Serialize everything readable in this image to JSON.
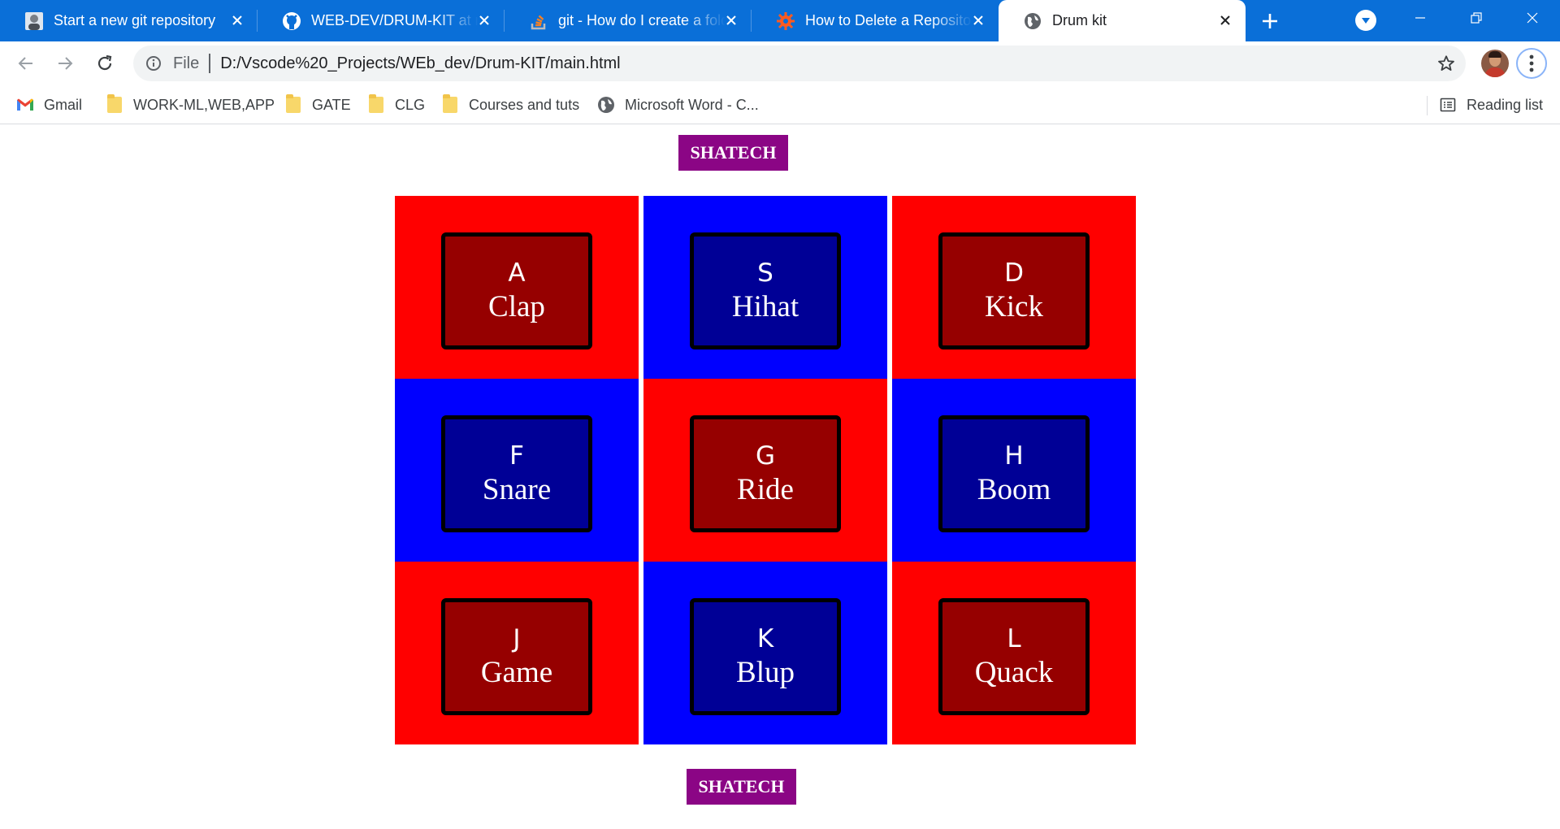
{
  "browser": {
    "tabs": [
      {
        "title": "Start a new git repository",
        "favicon": "user-avatar-icon",
        "active": false
      },
      {
        "title": "WEB-DEV/DRUM-KIT at main",
        "favicon": "github-icon",
        "active": false
      },
      {
        "title": "git - How do I create a folder",
        "favicon": "stackoverflow-icon",
        "active": false
      },
      {
        "title": "How to Delete a Repository",
        "favicon": "gear-orange-icon",
        "active": false
      },
      {
        "title": "Drum kit",
        "favicon": "globe-icon",
        "active": true
      }
    ],
    "tab_bar_color": "#0a6fd8",
    "address": {
      "scheme_label": "File",
      "url": "D:/Vscode%20_Projects/WEb_dev/Drum-KIT/main.html"
    },
    "bookmarks": [
      {
        "label": "Gmail",
        "icon": "gmail-icon"
      },
      {
        "label": "WORK-ML,WEB,APP",
        "icon": "folder-icon"
      },
      {
        "label": "GATE",
        "icon": "folder-icon"
      },
      {
        "label": "CLG",
        "icon": "folder-icon"
      },
      {
        "label": "Courses and tuts",
        "icon": "folder-icon"
      },
      {
        "label": "Microsoft Word - C...",
        "icon": "globe-icon"
      }
    ],
    "reading_list_label": "Reading list"
  },
  "page": {
    "brand_top": "SHATECH",
    "brand_bottom": "SHATECH",
    "brand_color": "#8b0585",
    "pads": [
      {
        "key": "A",
        "sound": "Clap",
        "cell_color": "#ff0000",
        "pad_color": "#960000"
      },
      {
        "key": "S",
        "sound": "Hihat",
        "cell_color": "#0000ff",
        "pad_color": "#000096"
      },
      {
        "key": "D",
        "sound": "Kick",
        "cell_color": "#ff0000",
        "pad_color": "#960000"
      },
      {
        "key": "F",
        "sound": "Snare",
        "cell_color": "#0000ff",
        "pad_color": "#000096"
      },
      {
        "key": "G",
        "sound": "Ride",
        "cell_color": "#ff0000",
        "pad_color": "#960000"
      },
      {
        "key": "H",
        "sound": "Boom",
        "cell_color": "#0000ff",
        "pad_color": "#000096"
      },
      {
        "key": "J",
        "sound": "Game",
        "cell_color": "#ff0000",
        "pad_color": "#960000"
      },
      {
        "key": "K",
        "sound": "Blup",
        "cell_color": "#0000ff",
        "pad_color": "#000096"
      },
      {
        "key": "L",
        "sound": "Quack",
        "cell_color": "#ff0000",
        "pad_color": "#960000"
      }
    ]
  }
}
